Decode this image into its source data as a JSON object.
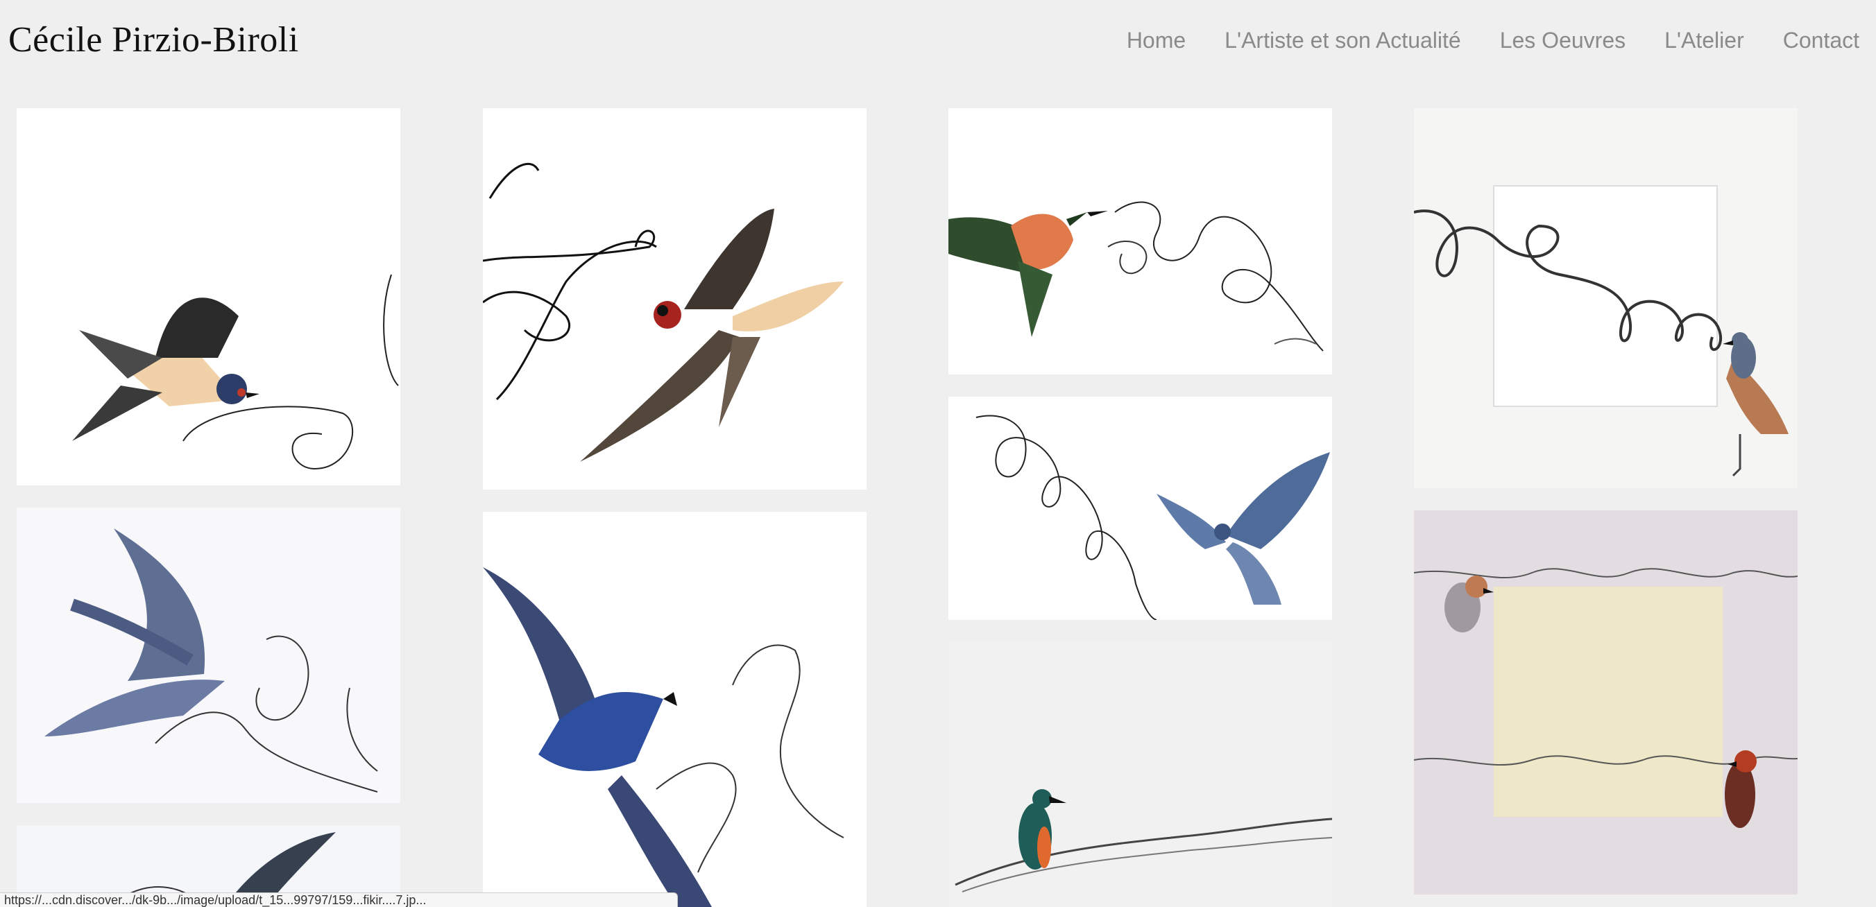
{
  "site": {
    "title": "Cécile Pirzio-Biroli"
  },
  "nav": {
    "items": [
      {
        "label": "Home"
      },
      {
        "label": "L'Artiste et son Actualité"
      },
      {
        "label": "Les Oeuvres"
      },
      {
        "label": "L'Atelier"
      },
      {
        "label": "Contact"
      }
    ]
  },
  "gallery": {
    "artworks": [
      {
        "subject": "barn swallow flying with scribble lines"
      },
      {
        "subject": "blue swallow with pencil loops"
      },
      {
        "subject": "swallow partially visible"
      },
      {
        "subject": "barn swallow with black scribbles"
      },
      {
        "subject": "blue bird with flowing lines"
      },
      {
        "subject": "hummingbird with tangled lines"
      },
      {
        "subject": "blue bird in flight with spiral line"
      },
      {
        "subject": "kingfisher on wire"
      },
      {
        "subject": "rock thrush with spiral scribble"
      },
      {
        "subject": "two finches with writing lines"
      }
    ]
  },
  "status_bar": {
    "url": "https://...cdn.discover.../dk-9b.../image/upload/t_15...99797/159...fikir....7.jp..."
  }
}
